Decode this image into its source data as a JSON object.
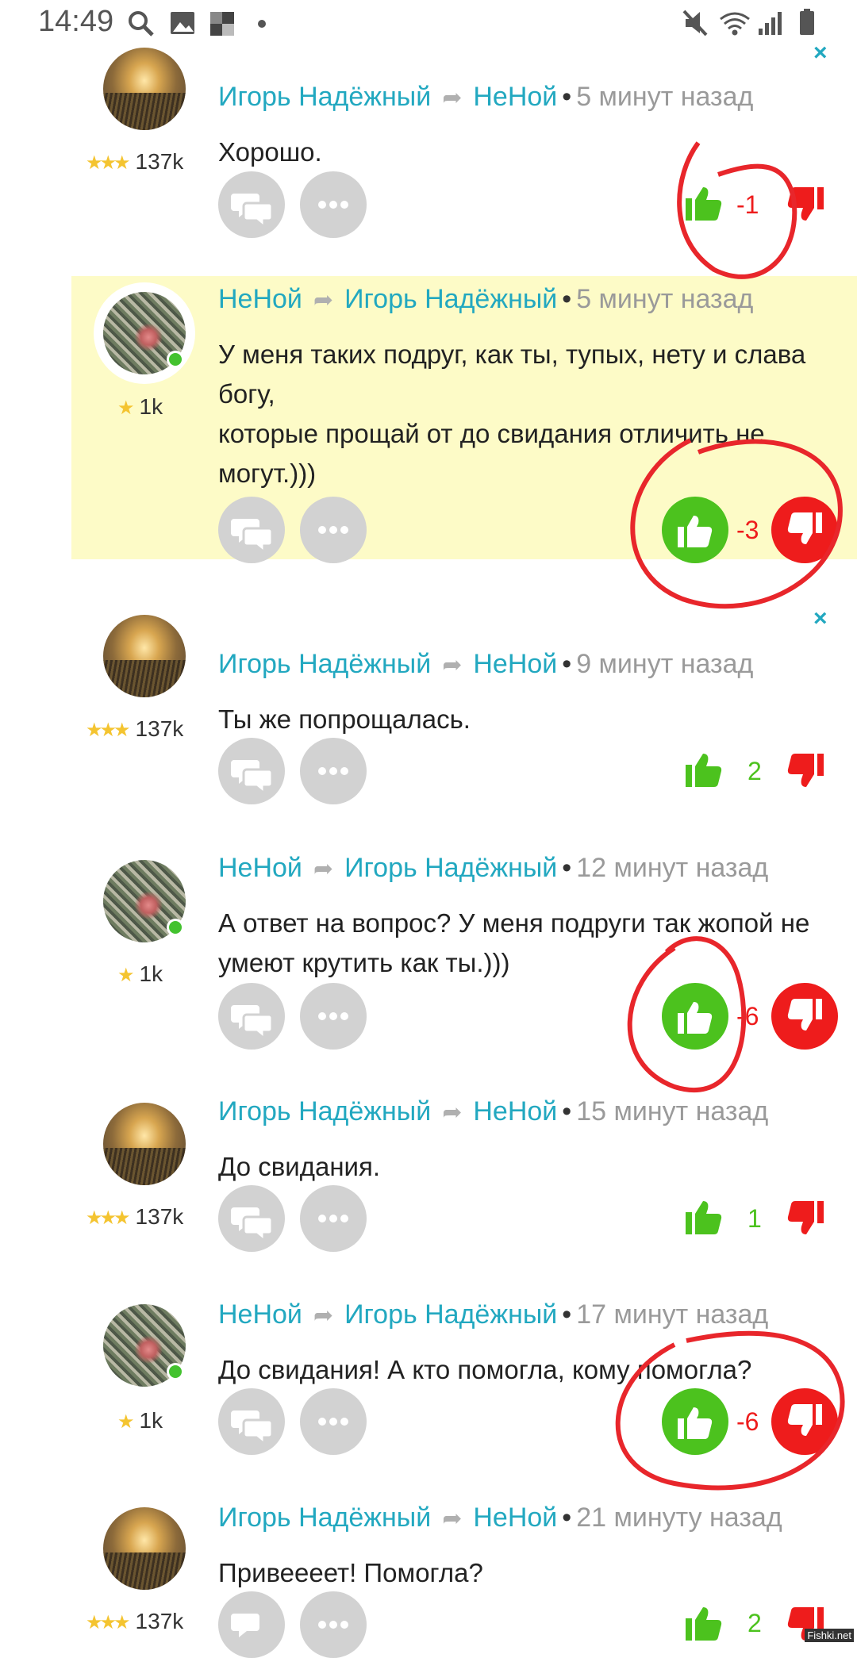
{
  "status_bar": {
    "time": "14:49",
    "icons_left": [
      "search-icon",
      "image-icon",
      "app-icon",
      "dot-icon"
    ],
    "icons_right": [
      "mute-icon",
      "wifi-icon",
      "signal-icon",
      "battery-icon"
    ]
  },
  "comments": [
    {
      "author": "Игорь Надёжный",
      "recipient": "НеНой",
      "time": "5 минут назад",
      "rating": "137k",
      "stars": 3,
      "text": "Хорошо.",
      "votes": "-1",
      "vote_style": "small",
      "highlighted": false,
      "closable": true
    },
    {
      "author": "НеНой",
      "recipient": "Игорь Надёжный",
      "time": "5 минут назад",
      "rating": "1k",
      "stars": 1,
      "text_lines": [
        "У меня таких подруг, как ты, тупых, нету и слава",
        "богу,",
        "которые прощай от до свидания отличить не",
        "могут.)))"
      ],
      "votes": "-3",
      "vote_style": "big",
      "highlighted": true,
      "closable": false
    },
    {
      "author": "Игорь Надёжный",
      "recipient": "НеНой",
      "time": "9 минут назад",
      "rating": "137k",
      "stars": 3,
      "text": "Ты же попрощалась.",
      "votes": "2",
      "vote_style": "small",
      "highlighted": false,
      "closable": true
    },
    {
      "author": "НеНой",
      "recipient": "Игорь Надёжный",
      "time": "12 минут назад",
      "rating": "1k",
      "stars": 1,
      "text_lines": [
        "А ответ на вопрос? У меня подруги так жопой не",
        "умеют крутить как ты.)))"
      ],
      "votes": "-6",
      "vote_style": "big",
      "highlighted": false,
      "closable": false
    },
    {
      "author": "Игорь Надёжный",
      "recipient": "НеНой",
      "time": "15 минут назад",
      "rating": "137k",
      "stars": 3,
      "text": "До свидания.",
      "votes": "1",
      "vote_style": "small",
      "highlighted": false,
      "closable": false
    },
    {
      "author": "НеНой",
      "recipient": "Игорь Надёжный",
      "time": "17 минут назад",
      "rating": "1k",
      "stars": 1,
      "text": "До свидания! А кто помогла, кому помогла?",
      "votes": "-6",
      "vote_style": "big",
      "highlighted": false,
      "closable": false
    },
    {
      "author": "Игорь Надёжный",
      "recipient": "НеНой",
      "time": "21 минуту назад",
      "rating": "137k",
      "stars": 3,
      "text": "Привеееет! Помогла?",
      "votes": "2",
      "vote_style": "small",
      "highlighted": false,
      "closable": false
    }
  ],
  "icons": {
    "close": "×",
    "star": "★",
    "arrow": "➦",
    "dot": "•"
  },
  "colors": {
    "link": "#22a8c0",
    "like": "#4cc21e",
    "dislike": "#ee1c1c",
    "highlight": "#fdfbc7",
    "annotation": "#e8262b"
  },
  "watermark": "Fishki.net"
}
